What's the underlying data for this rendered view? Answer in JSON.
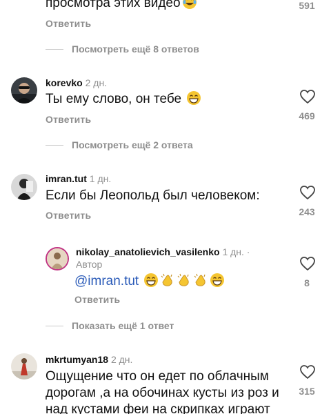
{
  "top": {
    "text": "просмотра этих видео",
    "emoji": "laughing-tears",
    "reply": "Ответить",
    "likes": "591",
    "more_replies": "Посмотреть ещё 8 ответов"
  },
  "comments": [
    {
      "user": "korevko",
      "time": "2 дн.",
      "text": "Ты ему слово, он тебе",
      "emoji": "grinning-face",
      "reply": "Ответить",
      "likes": "469",
      "more_replies": "Посмотреть ещё 2 ответа"
    },
    {
      "user": "imran.tut",
      "time": "1 дн.",
      "text": "Если бы Леопольд был человеком:",
      "reply": "Ответить",
      "likes": "243"
    },
    {
      "user": "mkrtumyan18",
      "time": "2 дн.",
      "text_lines": [
        "Ощущение что он едет по облачным",
        "дорогам ,а на обочинах кусты из роз и",
        "над кустами феи на скрипках играют"
      ],
      "likes": "315"
    }
  ],
  "nested_reply": {
    "user": "nikolay_anatolievich_vasilenko",
    "time": "1 дн. ·",
    "badge": "Автор",
    "mention": "@imran.tut",
    "emojis": [
      "grinning-face",
      "clapping-hands",
      "clapping-hands",
      "clapping-hands",
      "grinning-face"
    ],
    "reply": "Ответить",
    "likes": "8",
    "more_replies": "Показать ещё 1 ответ"
  }
}
